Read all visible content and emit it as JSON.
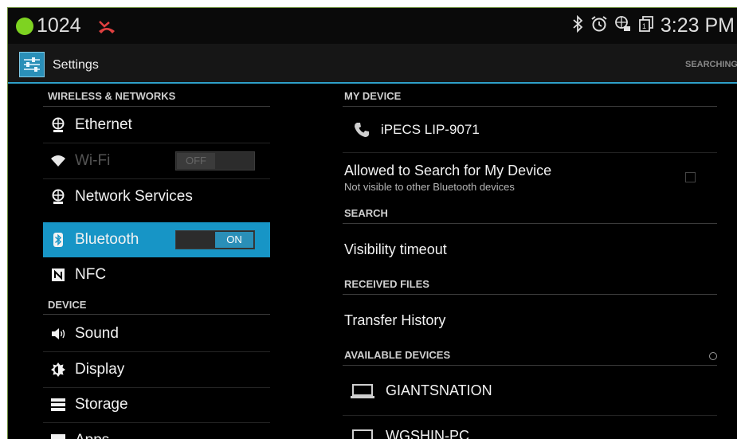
{
  "status": {
    "count": "1024",
    "time": "3:23 PM"
  },
  "actionbar": {
    "title": "Settings",
    "searching": "SEARCHING"
  },
  "sidebar": {
    "wireless_header": "WIRELESS & NETWORKS",
    "device_header": "DEVICE",
    "items": [
      {
        "label": "Ethernet",
        "icon": "globe-icon"
      },
      {
        "label": "Wi-Fi",
        "icon": "wifi-icon",
        "toggle": "OFF",
        "state": "disabled"
      },
      {
        "label": "Network Services",
        "icon": "globe-icon"
      },
      {
        "label": "Bluetooth",
        "icon": "bluetooth-icon",
        "toggle": "ON",
        "state": "selected"
      },
      {
        "label": "NFC",
        "icon": "nfc-icon"
      },
      {
        "label": "Sound",
        "icon": "speaker-icon"
      },
      {
        "label": "Display",
        "icon": "brightness-icon"
      },
      {
        "label": "Storage",
        "icon": "storage-icon"
      },
      {
        "label": "Apps",
        "icon": "apps-icon"
      }
    ]
  },
  "main": {
    "my_device_header": "MY DEVICE",
    "device_name": "iPECS LIP-9071",
    "allowed_title": "Allowed to Search for My Device",
    "allowed_sub": "Not visible to other Bluetooth devices",
    "search_header": "SEARCH",
    "visibility_timeout": "Visibility timeout",
    "received_header": "RECEIVED FILES",
    "transfer_history": "Transfer History",
    "available_header": "AVAILABLE DEVICES",
    "devices": [
      {
        "name": "GIANTSNATION",
        "icon": "laptop-icon"
      },
      {
        "name": "WGSHIN-PC",
        "icon": "laptop-icon"
      }
    ]
  },
  "colors": {
    "accent": "#1795c6",
    "background": "#000000",
    "status_dot": "#7ed321"
  }
}
